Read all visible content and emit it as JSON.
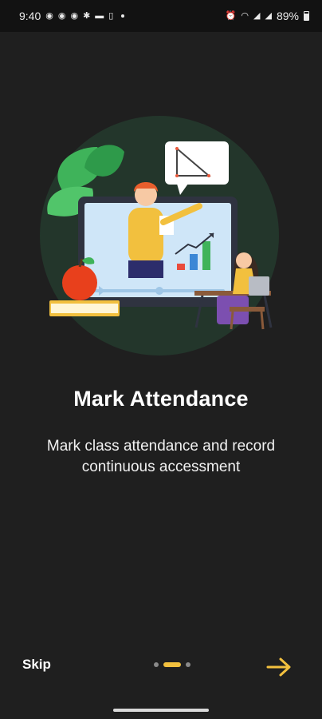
{
  "status_bar": {
    "time": "9:40",
    "battery_percent": "89%",
    "left_icons": [
      "whatsapp-icon",
      "telegram-icon",
      "telegram-icon",
      "slack-icon",
      "message-icon",
      "sim-icon"
    ],
    "right_icons": [
      "alarm-icon",
      "wifi-icon",
      "signal-icon",
      "signal-icon",
      "battery-icon"
    ]
  },
  "onboarding": {
    "title": "Mark Attendance",
    "subtitle": "Mark class attendance and record continuous accessment",
    "illustration": "teacher-video-class-illustration"
  },
  "footer": {
    "skip_label": "Skip",
    "page_count": 3,
    "active_page": 2,
    "next_icon": "arrow-right-icon",
    "accent_color": "#f2c03e"
  }
}
